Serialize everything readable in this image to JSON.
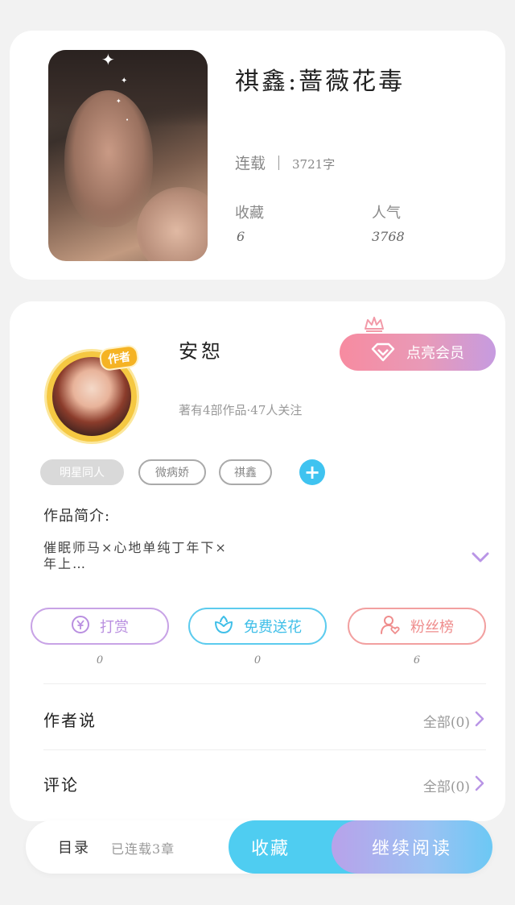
{
  "book": {
    "title": "祺鑫:蔷薇花毒",
    "status": "连载",
    "word_count": "3721字",
    "favorites_label": "收藏",
    "favorites_value": "6",
    "popularity_label": "人气",
    "popularity_value": "3768"
  },
  "author": {
    "name": "安恕",
    "badge": "作者",
    "meta": "著有4部作品·47人关注",
    "vip_button": "点亮会员"
  },
  "tags": [
    "明星同人",
    "微病娇",
    "祺鑫"
  ],
  "intro": {
    "label": "作品简介:",
    "text": "催眠师马×心地单纯丁年下×年上…"
  },
  "actions": [
    {
      "label": "打赏",
      "count": "0"
    },
    {
      "label": "免费送花",
      "count": "0"
    },
    {
      "label": "粉丝榜",
      "count": "6"
    }
  ],
  "rows": [
    {
      "title": "作者说",
      "right": "全部(0)"
    },
    {
      "title": "评论",
      "right": "全部(0)"
    }
  ],
  "bottom_bar": {
    "toc": "目录",
    "toc_status": "已连载3章",
    "collect": "收藏",
    "read": "继续阅读"
  },
  "colors": {
    "accent_blue": "#4fcdf1",
    "accent_purple": "#b98fe0",
    "accent_pink": "#ef8d8d",
    "vip_gradient_start": "#f78ba0",
    "vip_gradient_end": "#c69be0"
  }
}
